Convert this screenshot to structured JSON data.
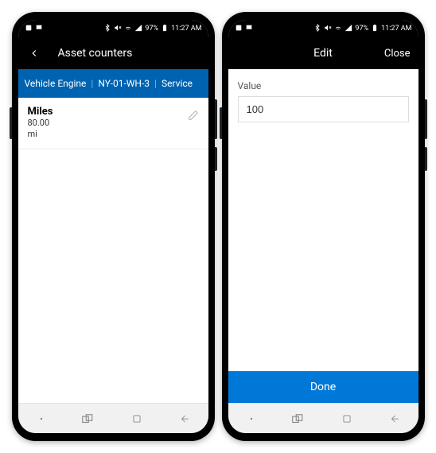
{
  "status": {
    "battery": "97%",
    "time": "11:27 AM"
  },
  "screen_left": {
    "title": "Asset counters",
    "context": {
      "asset_type": "Vehicle Engine",
      "asset_id": "NY-01-WH-3",
      "mode": "Service"
    },
    "counter": {
      "name": "Miles",
      "value": "80.00",
      "unit": "mi"
    }
  },
  "screen_right": {
    "title": "Edit",
    "close_label": "Close",
    "field_label": "Value",
    "field_value": "100",
    "done_label": "Done"
  }
}
